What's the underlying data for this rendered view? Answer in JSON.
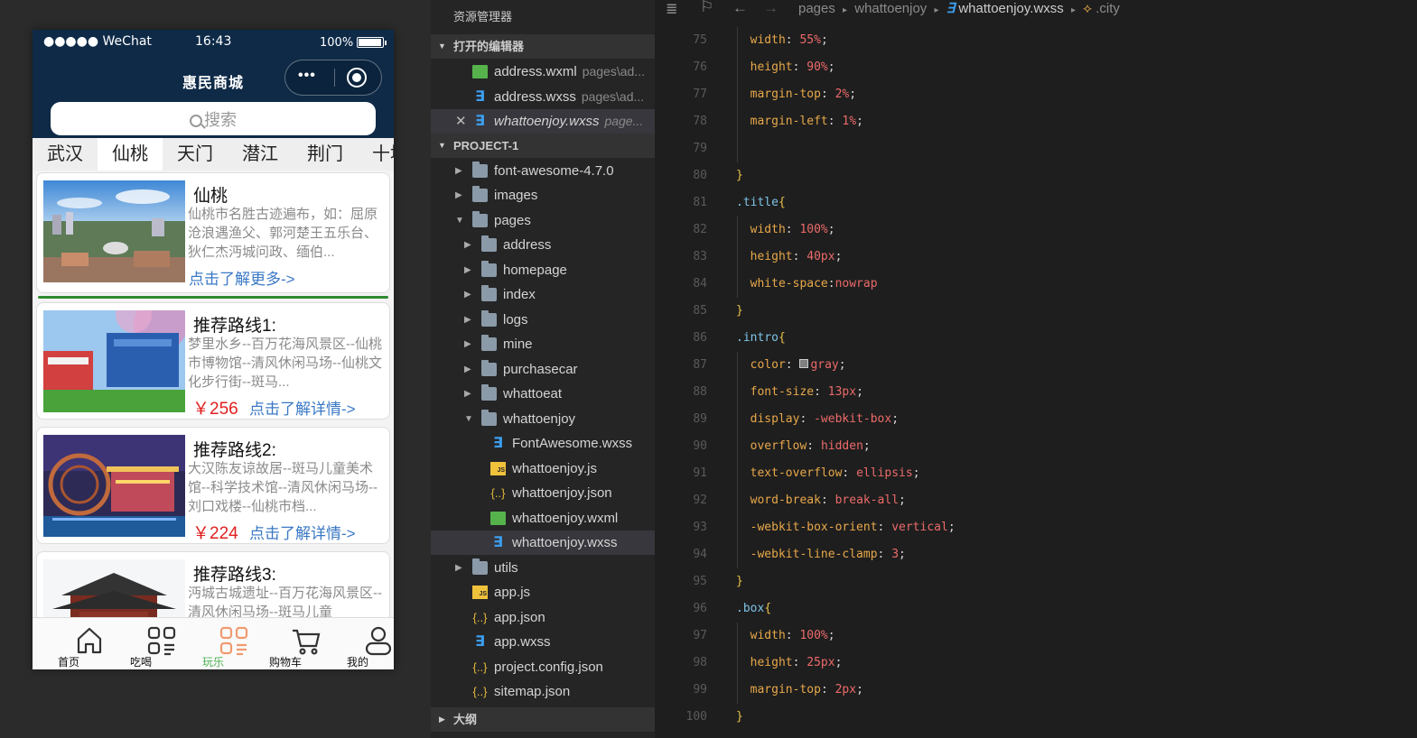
{
  "phone": {
    "status": {
      "carrier": "●●●●● WeChat",
      "time": "16:43",
      "battery": "100%"
    },
    "title": "惠民商城",
    "capsule_more": "•••",
    "search_placeholder": "搜索",
    "cities": [
      "武汉",
      "仙桃",
      "天门",
      "潜江",
      "荆门",
      "十堰"
    ],
    "active_city": 1,
    "cards": [
      {
        "title": "仙桃",
        "intro": "仙桃市名胜古迹遍布，如：屈原沧浪遇渔父、郭河楚王五乐台、狄仁杰沔城问政、缅伯...",
        "more": "点击了解更多->",
        "price": ""
      },
      {
        "title": "推荐路线1:",
        "intro": "梦里水乡--百万花海风景区--仙桃市博物馆--清风休闲马场--仙桃文化步行街--斑马...",
        "more": "点击了解详情->",
        "price": "￥256"
      },
      {
        "title": "推荐路线2:",
        "intro": "大汉陈友谅故居--斑马儿童美术馆--科学技术馆--清风休闲马场--刘口戏楼--仙桃市档...",
        "more": "点击了解详情->",
        "price": "￥224"
      },
      {
        "title": "推荐路线3:",
        "intro": "沔城古城遗址--百万花海风景区--清风休闲马场--斑马儿童",
        "more": "",
        "price": ""
      }
    ],
    "tabs": [
      {
        "label": "首页",
        "icon": "home-icon"
      },
      {
        "label": "吃喝",
        "icon": "food-icon"
      },
      {
        "label": "玩乐",
        "icon": "play-icon"
      },
      {
        "label": "购物车",
        "icon": "cart-icon"
      },
      {
        "label": "我的",
        "icon": "user-icon"
      }
    ],
    "active_tab": 2
  },
  "explorer": {
    "title": "资源管理器",
    "open_editors_header": "打开的编辑器",
    "open_editors": [
      {
        "name": "address.wxml",
        "path": "pages\\ad...",
        "type": "wxml"
      },
      {
        "name": "address.wxss",
        "path": "pages\\ad...",
        "type": "wxss"
      },
      {
        "name": "whattoenjoy.wxss",
        "path": "page...",
        "type": "wxss"
      }
    ],
    "project_header": "PROJECT-1",
    "tree": [
      {
        "name": "font-awesome-4.7.0",
        "kind": "folder"
      },
      {
        "name": "images",
        "kind": "folder"
      },
      {
        "name": "pages",
        "kind": "folder"
      },
      {
        "name": "address",
        "kind": "folder"
      },
      {
        "name": "homepage",
        "kind": "folder"
      },
      {
        "name": "index",
        "kind": "folder"
      },
      {
        "name": "logs",
        "kind": "folder"
      },
      {
        "name": "mine",
        "kind": "folder"
      },
      {
        "name": "purchasecar",
        "kind": "folder"
      },
      {
        "name": "whattoeat",
        "kind": "folder"
      },
      {
        "name": "whattoenjoy",
        "kind": "folder"
      },
      {
        "name": "FontAwesome.wxss",
        "kind": "wxss"
      },
      {
        "name": "whattoenjoy.js",
        "kind": "js"
      },
      {
        "name": "whattoenjoy.json",
        "kind": "json"
      },
      {
        "name": "whattoenjoy.wxml",
        "kind": "wxml"
      },
      {
        "name": "whattoenjoy.wxss",
        "kind": "wxss"
      },
      {
        "name": "utils",
        "kind": "folder"
      },
      {
        "name": "app.js",
        "kind": "js"
      },
      {
        "name": "app.json",
        "kind": "json"
      },
      {
        "name": "app.wxss",
        "kind": "wxss"
      },
      {
        "name": "project.config.json",
        "kind": "json"
      },
      {
        "name": "sitemap.json",
        "kind": "json"
      }
    ],
    "outline_header": "大纲"
  },
  "editor": {
    "breadcrumb": [
      "pages",
      "whattoenjoy",
      "whattoenjoy.wxss",
      ".city"
    ],
    "lines": [
      {
        "n": "75",
        "t": "  width: 55%;"
      },
      {
        "n": "76",
        "t": "  height: 90%;"
      },
      {
        "n": "77",
        "t": "  margin-top: 2%;"
      },
      {
        "n": "78",
        "t": "  margin-left: 1%;"
      },
      {
        "n": "79",
        "t": ""
      },
      {
        "n": "80",
        "t": "}"
      },
      {
        "n": "81",
        "t": ".title{"
      },
      {
        "n": "82",
        "t": "  width: 100%;"
      },
      {
        "n": "83",
        "t": "  height: 40px;"
      },
      {
        "n": "84",
        "t": "  white-space:nowrap"
      },
      {
        "n": "85",
        "t": "}"
      },
      {
        "n": "86",
        "t": ".intro{"
      },
      {
        "n": "87",
        "t": "  color: ■gray;"
      },
      {
        "n": "88",
        "t": "  font-size: 13px;"
      },
      {
        "n": "89",
        "t": "  display: -webkit-box;"
      },
      {
        "n": "90",
        "t": "  overflow: hidden;"
      },
      {
        "n": "91",
        "t": "  text-overflow: ellipsis;"
      },
      {
        "n": "92",
        "t": "  word-break: break-all;"
      },
      {
        "n": "93",
        "t": "  -webkit-box-orient: vertical;"
      },
      {
        "n": "94",
        "t": "  -webkit-line-clamp: 3;"
      },
      {
        "n": "95",
        "t": "}"
      },
      {
        "n": "96",
        "t": ".box{"
      },
      {
        "n": "97",
        "t": "  width: 100%;"
      },
      {
        "n": "98",
        "t": "  height: 25px;"
      },
      {
        "n": "99",
        "t": "  margin-top: 2px;"
      },
      {
        "n": "100",
        "t": "}"
      }
    ]
  }
}
